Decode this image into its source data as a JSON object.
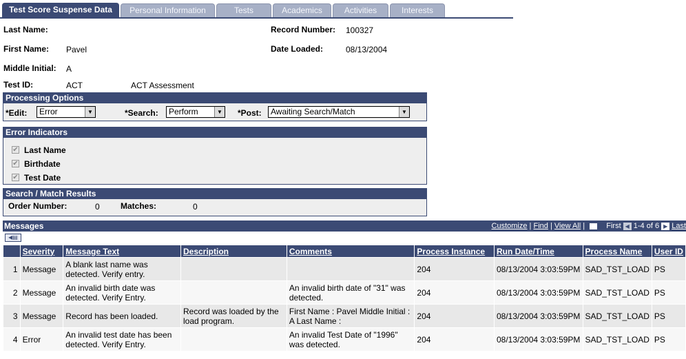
{
  "tabs": [
    {
      "label": "Test Score Suspense Data",
      "active": true
    },
    {
      "label": "Personal Information",
      "active": false
    },
    {
      "label": "Tests",
      "active": false
    },
    {
      "label": "Academics",
      "active": false
    },
    {
      "label": "Activities",
      "active": false
    },
    {
      "label": "Interests",
      "active": false
    }
  ],
  "header": {
    "last_name_label": "Last Name:",
    "last_name": "",
    "first_name_label": "First Name:",
    "first_name": "Pavel",
    "middle_initial_label": "Middle Initial:",
    "middle_initial": "A",
    "test_id_label": "Test ID:",
    "test_id": "ACT",
    "test_desc": "ACT Assessment",
    "record_number_label": "Record Number:",
    "record_number": "100327",
    "date_loaded_label": "Date Loaded:",
    "date_loaded": "08/13/2004"
  },
  "processing": {
    "title": "Processing Options",
    "edit_label": "*Edit:",
    "edit_value": "Error",
    "search_label": "*Search:",
    "search_value": "Perform",
    "post_label": "*Post:",
    "post_value": "Awaiting Search/Match"
  },
  "errors": {
    "title": "Error Indicators",
    "items": [
      {
        "label": "Last Name",
        "checked": true
      },
      {
        "label": "Birthdate",
        "checked": true
      },
      {
        "label": "Test Date",
        "checked": true
      }
    ]
  },
  "search_match": {
    "title": "Search / Match Results",
    "order_label": "Order Number:",
    "order_value": "0",
    "matches_label": "Matches:",
    "matches_value": "0"
  },
  "messages": {
    "title": "Messages",
    "customize": "Customize",
    "find": "Find",
    "view_all": "View All",
    "first": "First",
    "range": "1-4 of 6",
    "last": "Last",
    "columns": [
      "Severity",
      "Message Text",
      "Description",
      "Comments",
      "Process Instance",
      "Run Date/Time",
      "Process Name",
      "User ID"
    ],
    "rows": [
      {
        "n": "1",
        "severity": "Message",
        "text": "A blank last name was detected.  Verify entry.",
        "description": "",
        "comments": "",
        "instance": "204",
        "run": "08/13/2004  3:03:59PM",
        "process": "SAD_TST_LOAD",
        "user": "PS"
      },
      {
        "n": "2",
        "severity": "Message",
        "text": "An invalid birth date was detected. Verify Entry.",
        "description": "",
        "comments": "An invalid birth date of \"31\" was detected.",
        "instance": "204",
        "run": "08/13/2004  3:03:59PM",
        "process": "SAD_TST_LOAD",
        "user": "PS"
      },
      {
        "n": "3",
        "severity": "Message",
        "text": "Record has been loaded.",
        "description": "Record was loaded by the load program.",
        "comments": "First Name : Pavel  Middle Initial : A  Last Name :",
        "instance": "204",
        "run": "08/13/2004  3:03:59PM",
        "process": "SAD_TST_LOAD",
        "user": "PS"
      },
      {
        "n": "4",
        "severity": "Error",
        "text": "An invalid test date has been detected. Verify Entry.",
        "description": "",
        "comments": "An invalid Test Date of \"1996\" was detected.",
        "instance": "204",
        "run": "08/13/2004  3:03:59PM",
        "process": "SAD_TST_LOAD",
        "user": "PS"
      }
    ]
  }
}
